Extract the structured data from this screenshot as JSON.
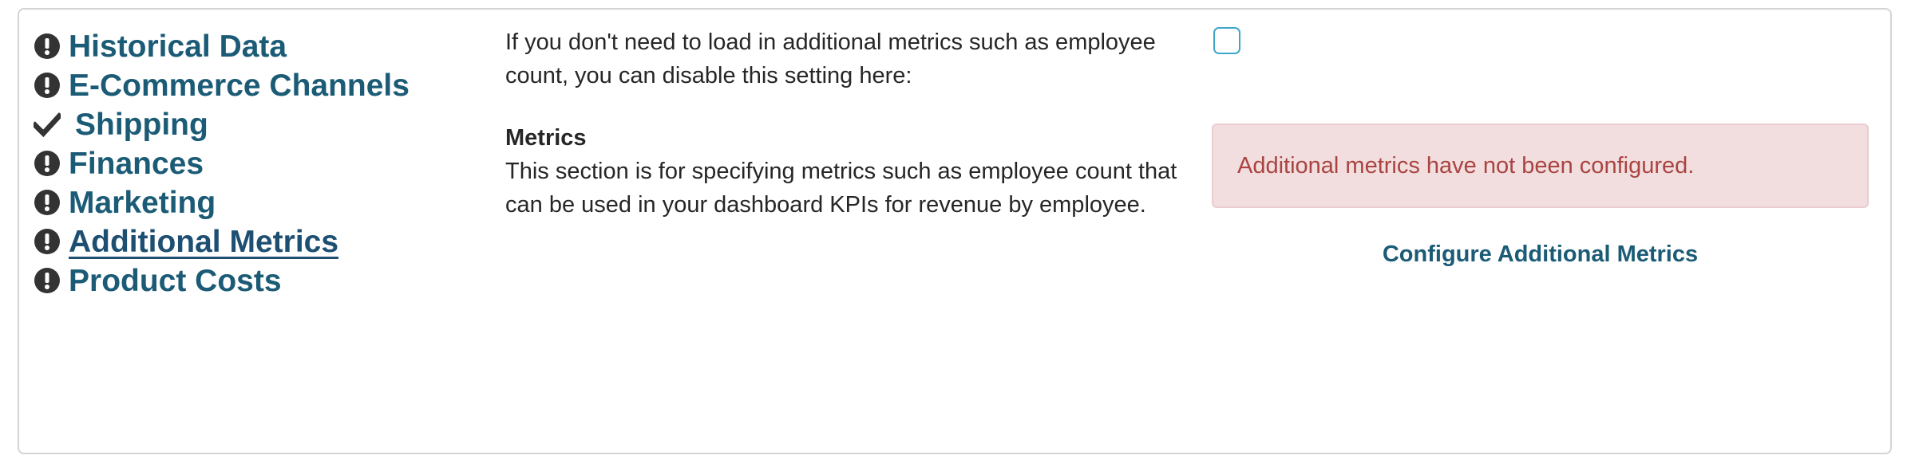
{
  "nav": {
    "items": [
      {
        "label": "Historical Data",
        "icon": "exclamation-circle-icon",
        "status": "incomplete",
        "active": false
      },
      {
        "label": "E-Commerce Channels",
        "icon": "exclamation-circle-icon",
        "status": "incomplete",
        "active": false
      },
      {
        "label": "Shipping",
        "icon": "checkmark-icon",
        "status": "complete",
        "active": false
      },
      {
        "label": "Finances",
        "icon": "exclamation-circle-icon",
        "status": "incomplete",
        "active": false
      },
      {
        "label": "Marketing",
        "icon": "exclamation-circle-icon",
        "status": "incomplete",
        "active": false
      },
      {
        "label": "Additional Metrics",
        "icon": "exclamation-circle-icon",
        "status": "incomplete",
        "active": true
      },
      {
        "label": "Product Costs",
        "icon": "exclamation-circle-icon",
        "status": "incomplete",
        "active": false
      }
    ]
  },
  "content": {
    "intro": "If you don't need to load in additional metrics such as employee count, you can disable this setting here:",
    "metrics_title": "Metrics",
    "metrics_description": "This section is for specifying metrics such as employee count that can be used in your dashboard KPIs for revenue by employee.",
    "disable_checkbox_checked": false,
    "alert_text": "Additional metrics have not been configured.",
    "configure_link": "Configure Additional Metrics"
  },
  "colors": {
    "nav_text": "#1b5b76",
    "alert_bg": "#f2dede",
    "alert_text": "#a94442",
    "checkbox_border": "#3ea7c9",
    "icon": "#333333"
  }
}
